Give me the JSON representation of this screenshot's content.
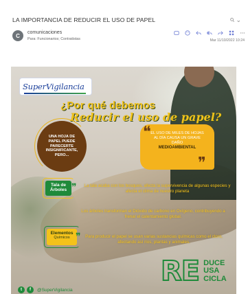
{
  "email": {
    "subject": "LA IMPORTANCIA DE REDUCIR EL USO DE PAPEL",
    "sender": {
      "initial": "C",
      "name": "comunicaciones"
    },
    "recipients": "Para: Funcionarios; Contratistas",
    "date": "Mar 11/10/2022 10:24"
  },
  "poster": {
    "logo": "SuperVigilancia",
    "headline_line1": "¿Por qué debemos",
    "headline_line2": "Reducir el uso de papel?",
    "brown_bubble": "UNA HOJA DE PAPEL PUEDE PARECERTE INSIGNIFICANTE, PERO...",
    "orange_bubble_text": "EL USO DE MILES DE HOJAS AL DÍA CAUSA UN GRAVE DAÑO",
    "orange_bubble_strong": "MEDIOAMBIENTAL",
    "badge_tala_line1": "Tala de",
    "badge_tala_line2": "Árboles",
    "para1": "La tala acaba con los bosques, afecta la supervivencia de algunas especies y afecta el clima de nuestro planeta",
    "para2": "Los árboles transforman el Dióxido de carbono en Oxígeno, contribuyendo a frenar el calentamiento global.",
    "badge_elem_line1": "Elementos",
    "badge_elem_line2": "Químicos",
    "para3": "Para producir el papel se usan varias sustancias químicas como el cloro, afectando así ríos, plantas y animales.",
    "re_big": "RE",
    "re_words": [
      "DUCE",
      "USA",
      "CICLA"
    ],
    "social_handle": "@SuperVigilancia"
  },
  "colors": {
    "green": "#1f8a3a",
    "yellow": "#f4c21b",
    "orange": "#f4b31d",
    "brown": "#6b3c12",
    "logo_blue": "#1b3f9a"
  }
}
